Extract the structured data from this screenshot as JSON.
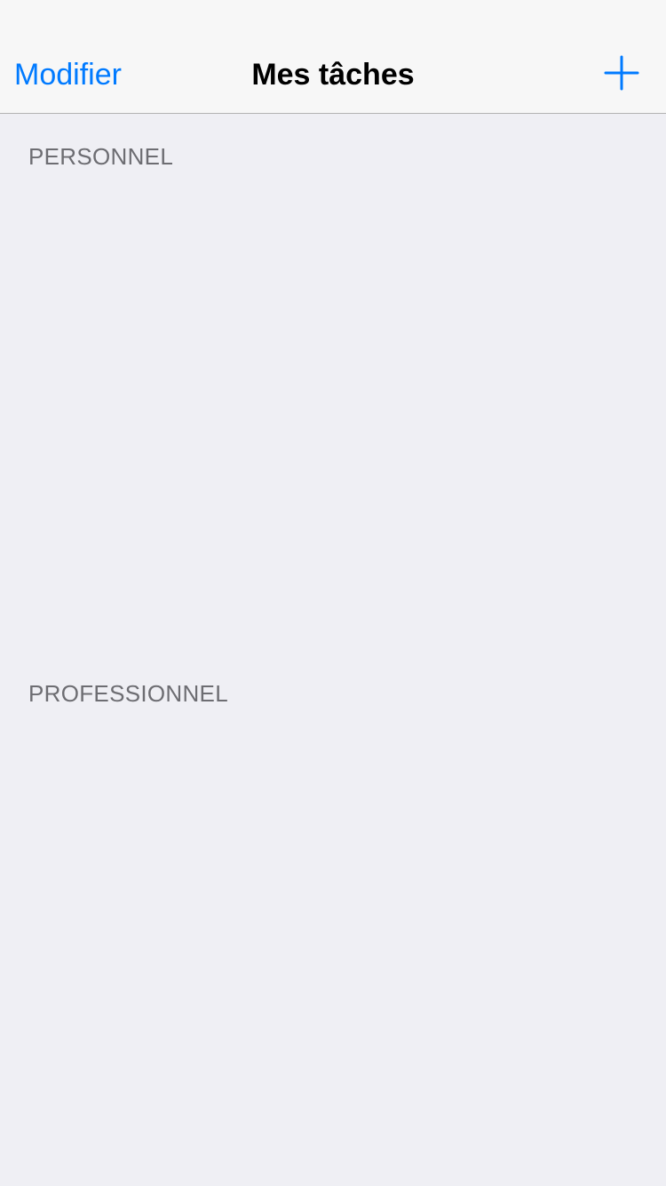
{
  "navbar": {
    "edit_label": "Modifier",
    "title": "Mes tâches",
    "add_icon": "plus-icon"
  },
  "sections": [
    {
      "header": "PERSONNEL"
    },
    {
      "header": "PROFESSIONNEL"
    }
  ],
  "colors": {
    "accent": "#007aff",
    "background": "#efeff4",
    "navbar_background": "#f7f7f7",
    "section_header_text": "#6d6d72"
  }
}
